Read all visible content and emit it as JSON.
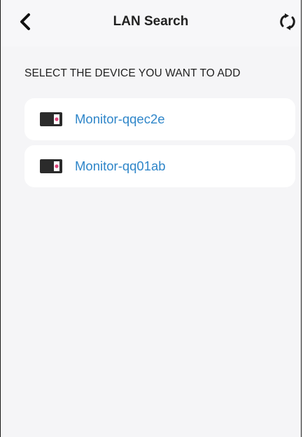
{
  "header": {
    "title": "LAN Search",
    "back_icon": "chevron-left-icon",
    "refresh_icon": "refresh-icon"
  },
  "section": {
    "label": "SELECT THE DEVICE YOU WANT TO ADD"
  },
  "devices": [
    {
      "name": "Monitor-qqec2e",
      "icon": "monitor-device-icon"
    },
    {
      "name": "Monitor-qq01ab",
      "icon": "monitor-device-icon"
    }
  ],
  "colors": {
    "background": "#f5f5f7",
    "card": "#ffffff",
    "accent": "#2f86c9",
    "device_led": "#e0457b"
  }
}
